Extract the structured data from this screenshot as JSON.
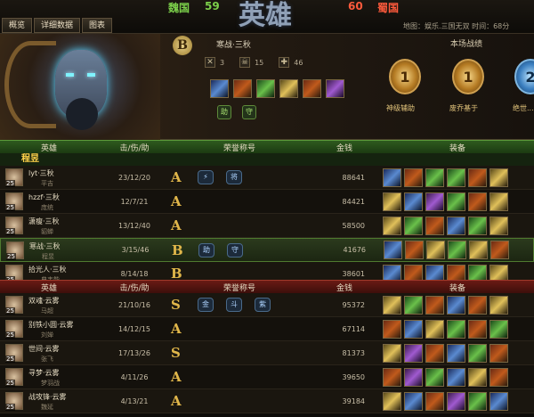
{
  "header": {
    "tabs": [
      "概览",
      "详细数据",
      "图表"
    ],
    "left_side": {
      "name": "魏国",
      "score": "59"
    },
    "right_side": {
      "name": "蜀国",
      "score": "60"
    },
    "logo_text": "英雄",
    "map_info": "地图：娱乐.三国无双    时间：68分"
  },
  "hero_panel": {
    "rank_grade": "B",
    "player_name": "寒战·三秋",
    "kills": "3",
    "deaths": "15",
    "assists": "46",
    "mvp_heading": "本场战绩",
    "medals": [
      {
        "digit": "1",
        "label": "神级辅助",
        "color": "gold"
      },
      {
        "digit": "1",
        "label": "废乔基于",
        "color": "gold"
      },
      {
        "digit": "2",
        "label": "绝世...",
        "color": "blue"
      }
    ]
  },
  "columns": {
    "hero": "英雄",
    "kda": "击/伤/助",
    "titles": "荣誉称号",
    "gold": "金钱",
    "items": "装备"
  },
  "team_green": {
    "name": "程昱",
    "players": [
      {
        "name": "lyt·三秋",
        "hero": "平吉",
        "level": "25",
        "kda": "23/12/20",
        "grade": "A",
        "titles": [
          "⚡",
          "将"
        ],
        "gold": "88641",
        "items": [
          "b",
          "r",
          "g",
          "g",
          "r",
          "y"
        ]
      },
      {
        "name": "hzzf·三秋",
        "hero": "庞统",
        "level": "25",
        "kda": "12/7/21",
        "grade": "A",
        "titles": [],
        "gold": "84421",
        "items": [
          "y",
          "b",
          "p",
          "g",
          "r",
          "y"
        ]
      },
      {
        "name": "潇瘦·三秋",
        "hero": "貂蝉",
        "level": "25",
        "kda": "13/12/40",
        "grade": "A",
        "titles": [],
        "gold": "58500",
        "items": [
          "y",
          "g",
          "r",
          "b",
          "g",
          "y"
        ]
      },
      {
        "name": "寒战·三秋",
        "hero": "程昱",
        "level": "25",
        "kda": "3/15/46",
        "grade": "B",
        "titles": [
          "助",
          "守"
        ],
        "gold": "41676",
        "items": [
          "b",
          "r",
          "y",
          "g",
          "y",
          "r"
        ],
        "highlight": true
      },
      {
        "name": "拾光人·三秋",
        "hero": "典韦能",
        "level": "25",
        "kda": "8/14/18",
        "grade": "B",
        "titles": [],
        "gold": "38601",
        "items": [
          "b",
          "r",
          "b",
          "r",
          "g",
          "y"
        ]
      }
    ]
  },
  "team_red": {
    "players": [
      {
        "name": "双魂·云雾",
        "hero": "马超",
        "level": "25",
        "kda": "21/10/16",
        "grade": "S",
        "titles": [
          "金",
          "斗",
          "紫"
        ],
        "gold": "95372",
        "items": [
          "y",
          "g",
          "r",
          "b",
          "r",
          "y"
        ]
      },
      {
        "name": "别铁小圆·云雾",
        "hero": "刘婵",
        "level": "25",
        "kda": "14/12/15",
        "grade": "A",
        "titles": [],
        "gold": "67114",
        "items": [
          "r",
          "b",
          "y",
          "g",
          "r",
          "g"
        ]
      },
      {
        "name": "世间·云雾",
        "hero": "张飞",
        "level": "25",
        "kda": "17/13/26",
        "grade": "S",
        "titles": [],
        "gold": "81373",
        "items": [
          "y",
          "p",
          "r",
          "b",
          "g",
          "r"
        ]
      },
      {
        "name": "寻梦·云雾",
        "hero": "梦羽战",
        "level": "25",
        "kda": "4/11/26",
        "grade": "A",
        "titles": [],
        "gold": "39650",
        "items": [
          "r",
          "p",
          "g",
          "b",
          "y",
          "r"
        ]
      },
      {
        "name": "战攻锋·云雾",
        "hero": "魏延",
        "level": "25",
        "kda": "4/13/21",
        "grade": "A",
        "titles": [],
        "gold": "39184",
        "items": [
          "y",
          "b",
          "r",
          "p",
          "g",
          "b"
        ]
      }
    ]
  }
}
